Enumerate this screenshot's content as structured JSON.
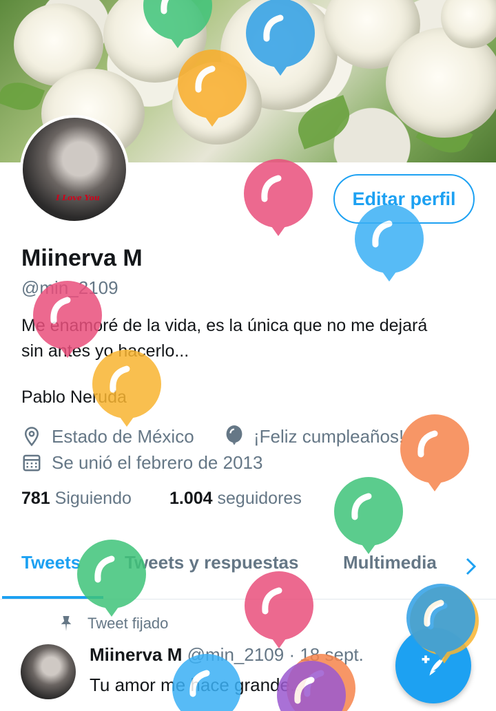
{
  "profile": {
    "name": "Miinerva M",
    "handle": "@min_2109",
    "edit_button": "Editar perfil",
    "bio_line1": "Me enamoré de la vida, es la única que no me dejará",
    "bio_line2": "sin antes yo hacerlo...",
    "bio_signature": "Pablo Neruda",
    "location": "Estado de México",
    "birthday": "¡Feliz cumpleaños!",
    "joined": "Se unió el febrero de 2013",
    "following_count": "781",
    "following_label": "Siguiendo",
    "followers_count": "1.004",
    "followers_label": "seguidores",
    "avatar_caption": "I Love You"
  },
  "tabs": {
    "tweets": "Tweets",
    "replies": "Tweets y respuestas",
    "media": "Multimedia"
  },
  "pinned_tweet": {
    "pinned_label": "Tweet fijado",
    "author": "Miinerva M",
    "handle": "@min_2109",
    "separator": "·",
    "date": "18 sept.",
    "text": "Tu amor me hace grande..."
  },
  "colors": {
    "accent": "#1da1f2",
    "text": "#14171a",
    "muted": "#657786"
  },
  "icons": {
    "location": "location-pin-icon",
    "birthday": "balloon-icon",
    "joined": "calendar-icon",
    "pinned": "pin-icon",
    "tabs_more": "chevron-right-icon",
    "compose": "compose-tweet-icon"
  }
}
